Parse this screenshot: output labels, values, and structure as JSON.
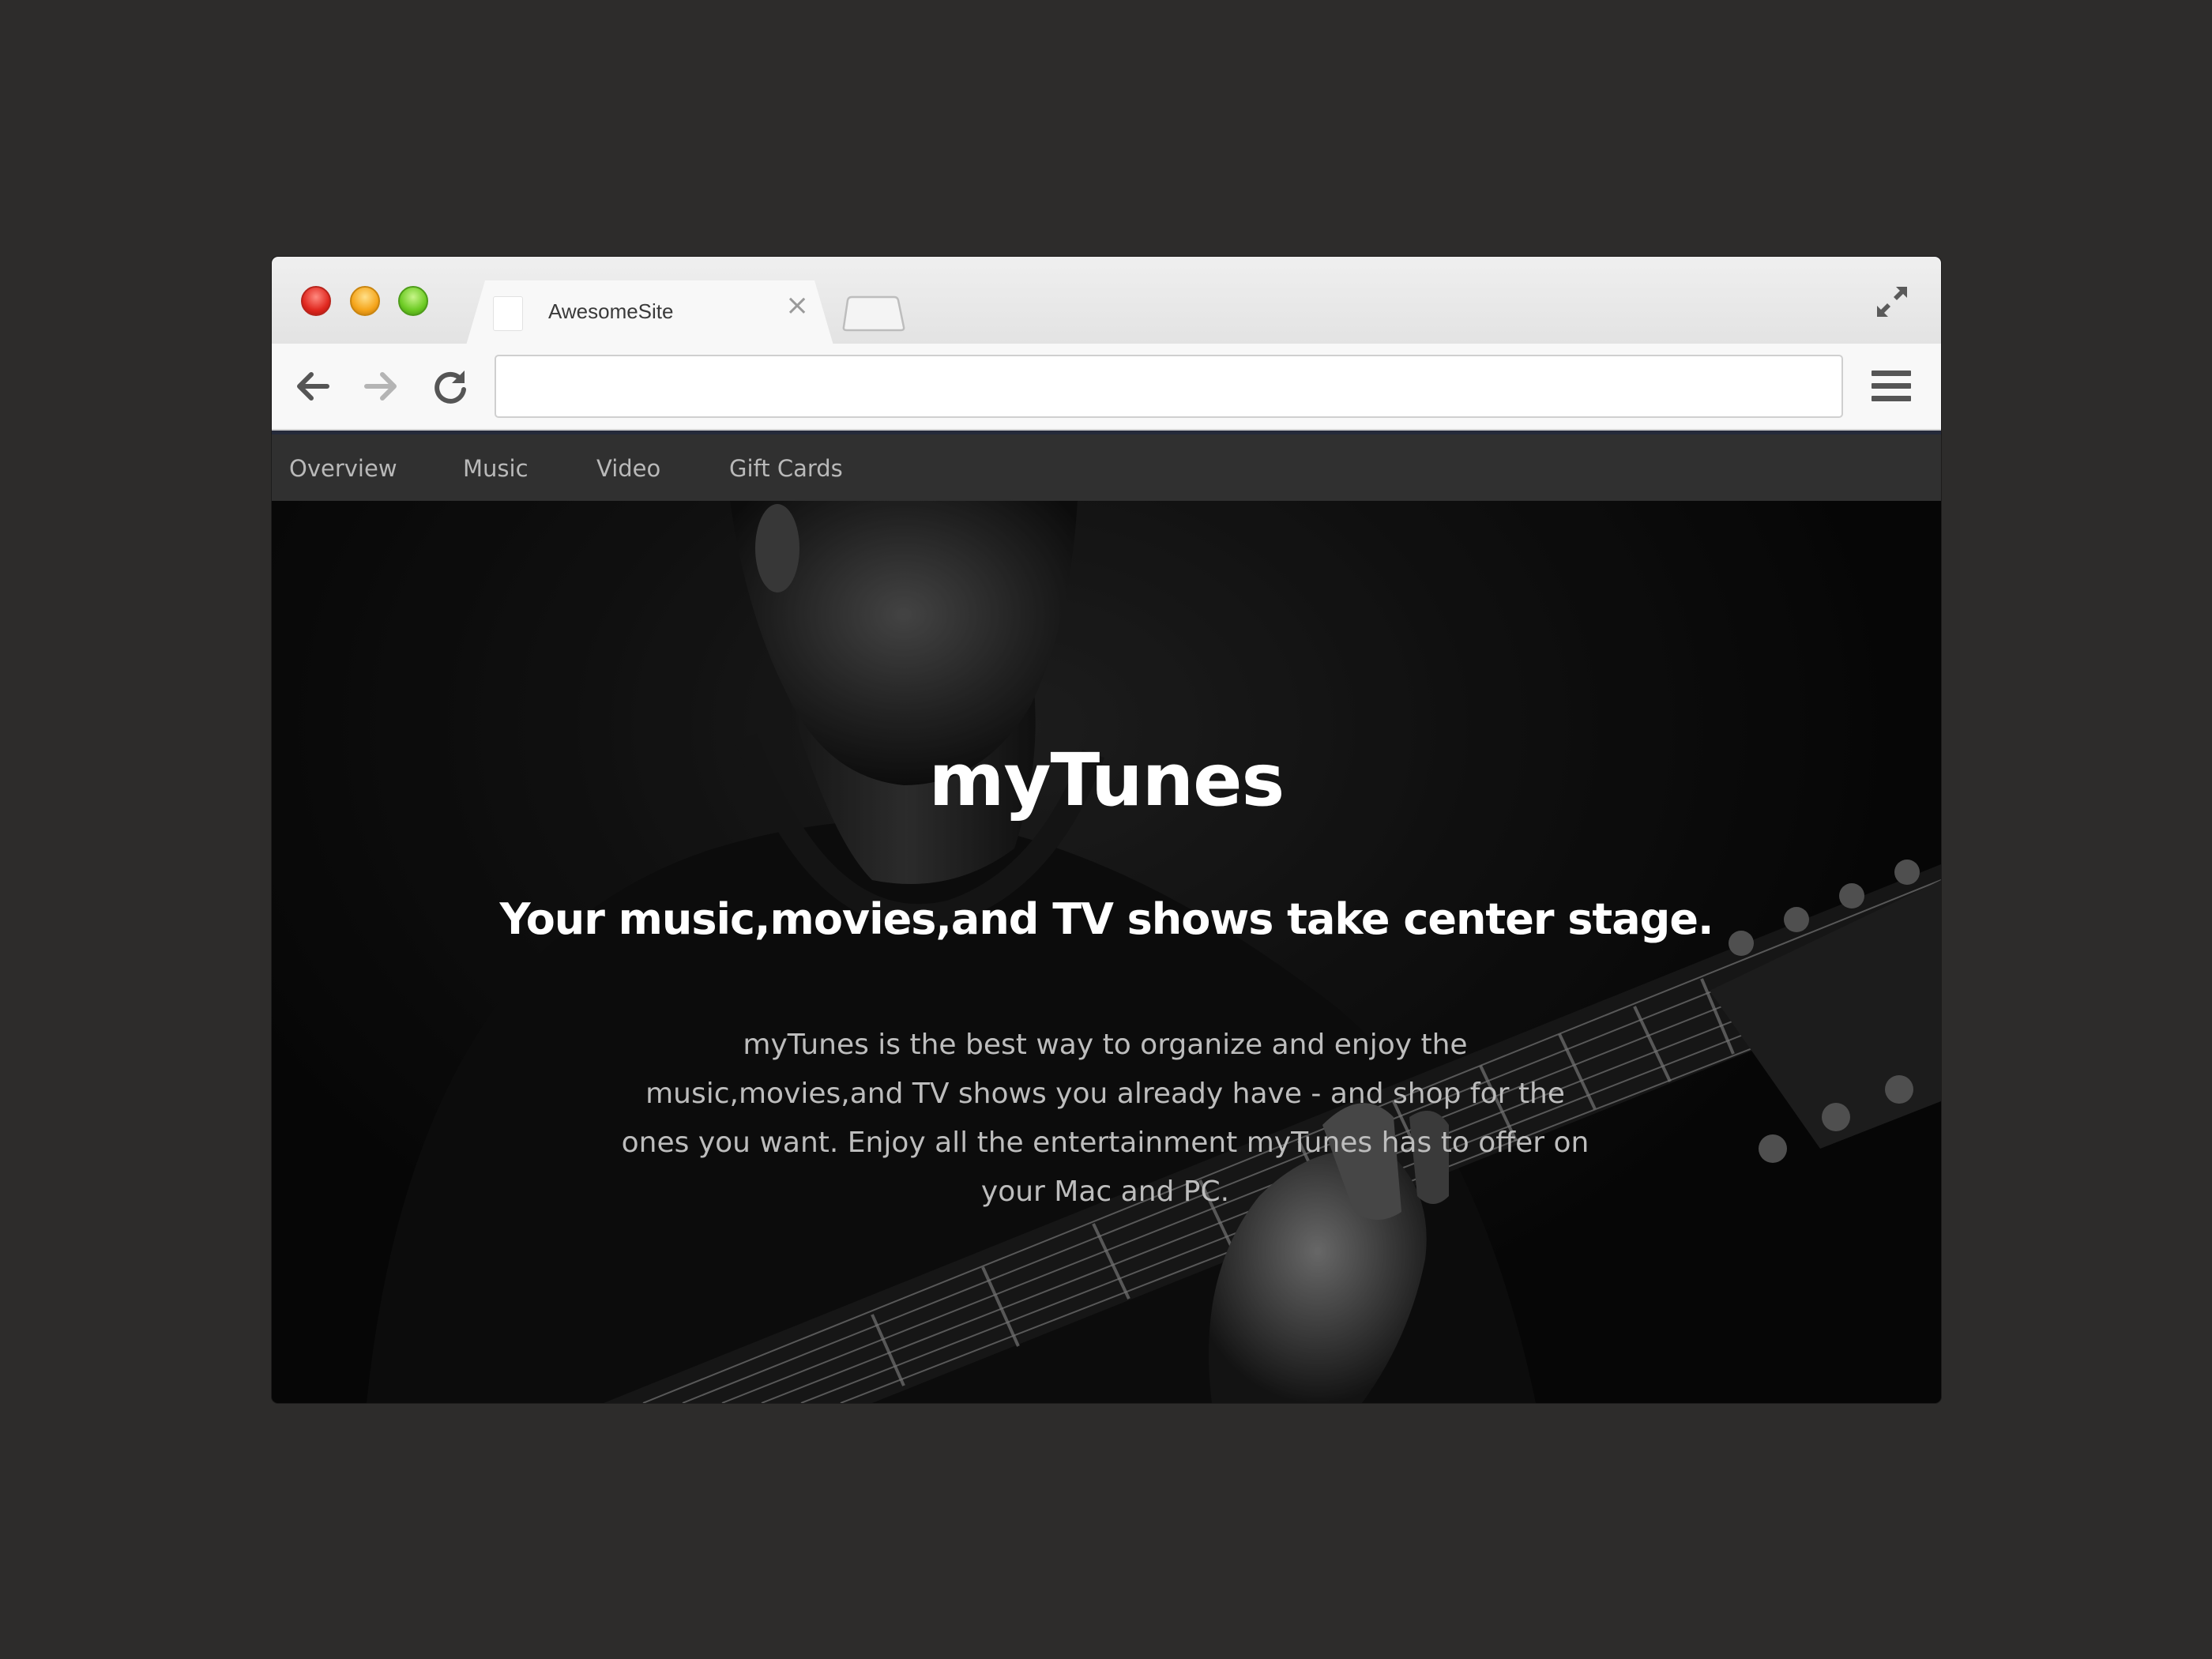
{
  "browser": {
    "tab": {
      "title": "AwesomeSite",
      "close_glyph": "×"
    },
    "address_bar": {
      "value": "",
      "placeholder": ""
    },
    "icons": {
      "close": "close-light",
      "minimize": "minimize-light",
      "maximize": "zoom-light",
      "back": "back-arrow-icon",
      "forward": "forward-arrow-icon",
      "reload": "reload-icon",
      "menu": "hamburger-menu-icon",
      "fullscreen": "fullscreen-icon"
    }
  },
  "site": {
    "nav": {
      "overview": "Overview",
      "music": "Music",
      "video": "Video",
      "gift_cards": "Gift Cards"
    },
    "hero": {
      "title": "myTunes",
      "subtitle": "Your music,movies,and TV shows take center stage.",
      "body": "myTunes is the best way to organize and enjoy the music,movies,and TV shows you already have - and shop for the ones you want. Enjoy all the entertainment myTunes has to offer on your Mac and PC."
    }
  },
  "colors": {
    "page_background": "#2d2c2b",
    "nav_background": "#303030",
    "nav_text": "#b9b9b9",
    "hero_title": "#ffffff",
    "hero_body": "#bdbdbd"
  }
}
